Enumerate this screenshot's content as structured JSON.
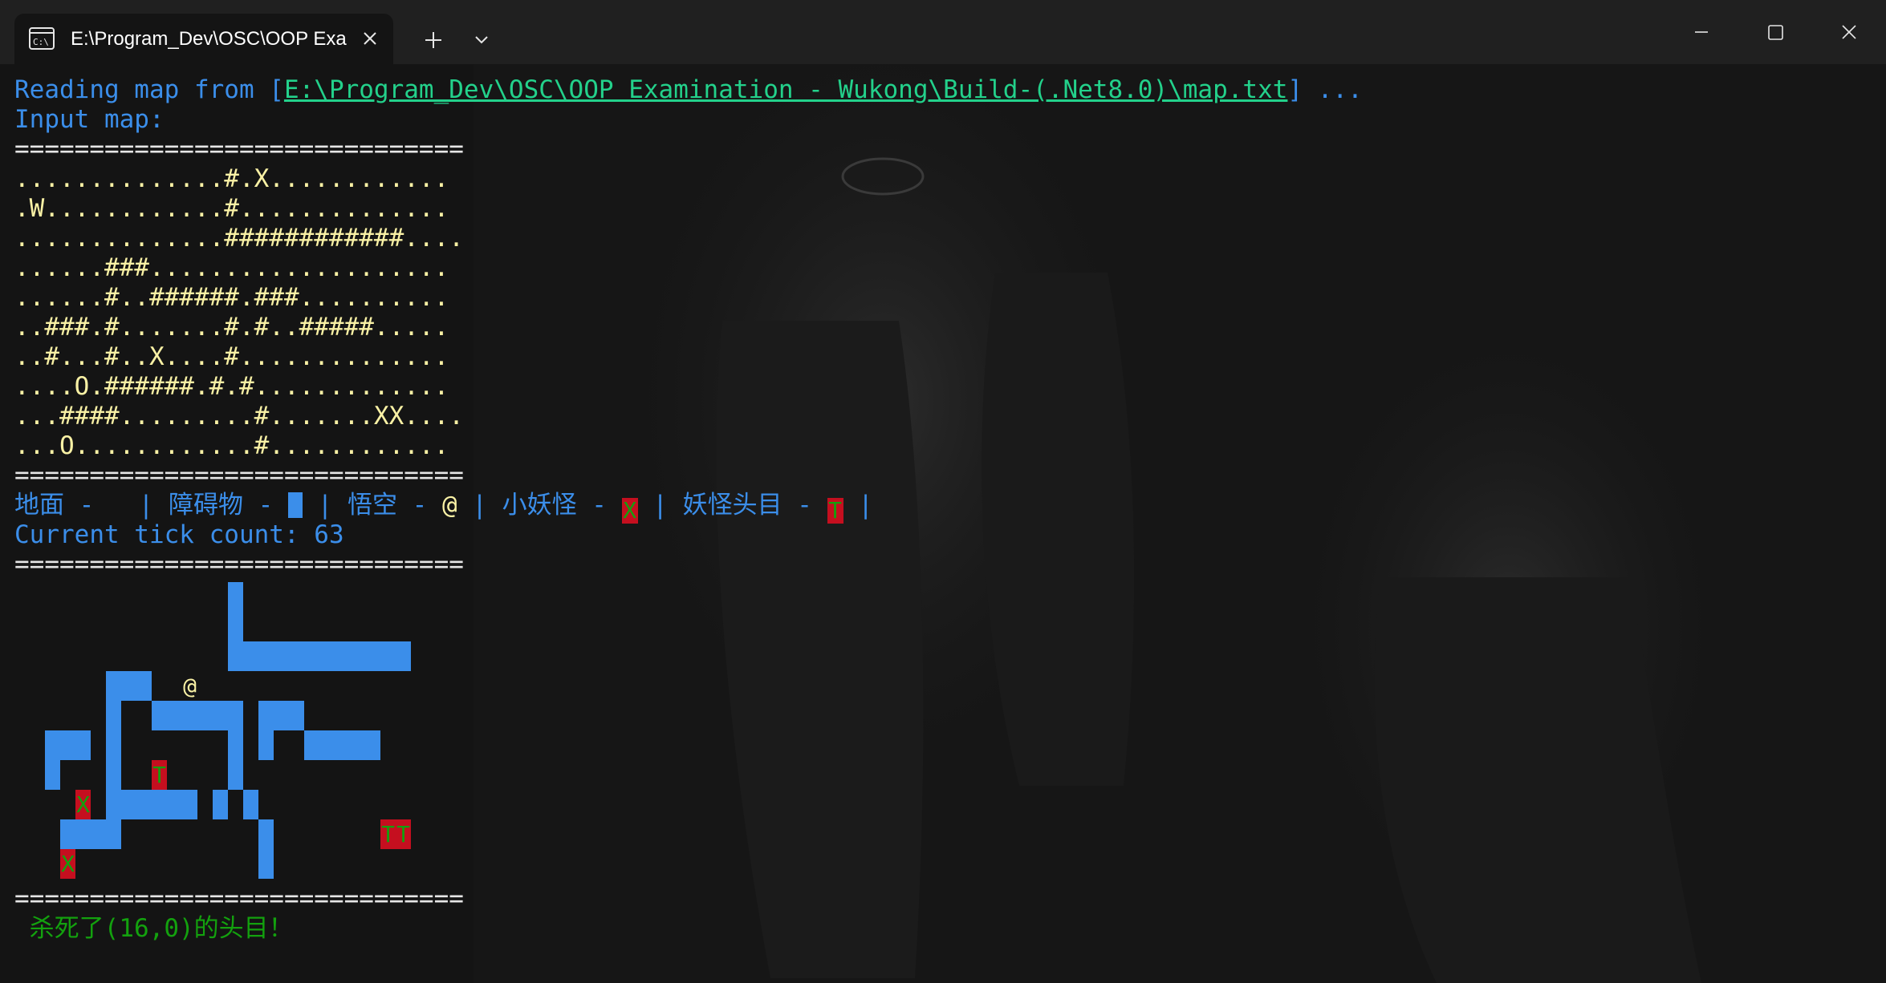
{
  "tab": {
    "title": "E:\\Program_Dev\\OSC\\OOP Exa",
    "icon": "terminal-icon"
  },
  "terminal": {
    "reading_prefix": "Reading map from ",
    "reading_bracket_open": "[",
    "reading_path": "E:\\Program_Dev\\OSC\\OOP Examination - Wukong\\Build-(.Net8.0)\\map.txt",
    "reading_suffix": "] ...",
    "input_map_label": "Input map:",
    "separator": "==============================",
    "map_rows": [
      "..............#.X............",
      ".W............#..............",
      "..............############....",
      "......###....................",
      "......#..######.###..........",
      "..###.#.......#.#..#####.....",
      "..#...#..X....#..............",
      "....O.######.#.#.............",
      "...####.........#.......XX....",
      "...O............#............"
    ],
    "legend": {
      "ground_label": "地面 - ",
      "ground_sample": " ",
      "obstacle_label": " | 障碍物 - ",
      "wukong_label": " | 悟空 - ",
      "wukong_symbol": "@",
      "minion_label": " | 小妖怪 - ",
      "minion_symbol": "X",
      "boss_label": " | 妖怪头目 - ",
      "boss_symbol": "T",
      "end_bar": " |"
    },
    "tick_label": "Current tick count: ",
    "tick_count": "63",
    "kill_message": " 杀死了(16,0)的头目！"
  },
  "render_grid": [
    "..............#..............",
    "..............#..............",
    "..............############...",
    "......###....................",
    "......#..######.###..........",
    "..###.#.......#.#..#####.....",
    "..#...#..T....#..............",
    "....X.######.#.#.............",
    "...####.........#.......TT...",
    "...X............#............"
  ],
  "wukong_pos": [
    11,
    3
  ],
  "colors": {
    "wall": "#3b8eea",
    "enemy_bg": "#c50f1f",
    "enemy_fg": "#13a10e",
    "wukong": "#f9f1a5"
  }
}
